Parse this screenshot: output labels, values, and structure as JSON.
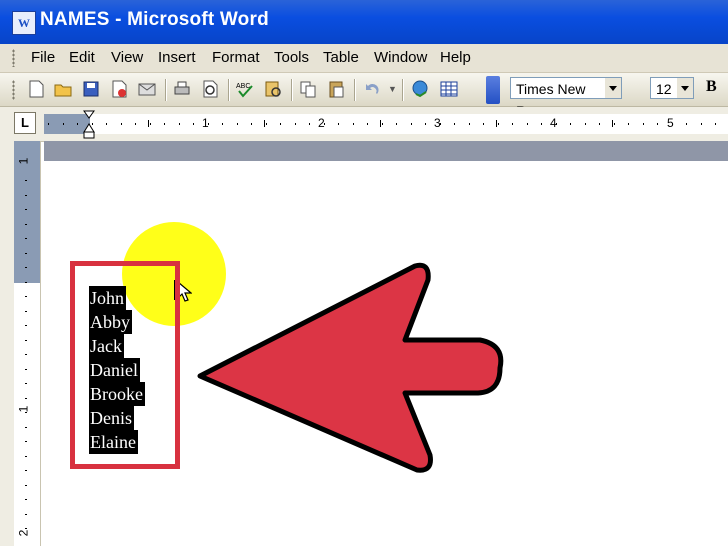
{
  "window": {
    "title": "NAMES - Microsoft Word",
    "app_icon_letter": "W"
  },
  "menu": [
    "File",
    "Edit",
    "View",
    "Insert",
    "Format",
    "Tools",
    "Table",
    "Window",
    "Help"
  ],
  "toolbar": {
    "icons": [
      "new-icon",
      "open-icon",
      "save-icon",
      "permission-icon",
      "email-icon",
      "print-icon",
      "print-preview-icon",
      "spelling-icon",
      "research-icon",
      "copy-icon",
      "paste-icon",
      "undo-icon",
      "hyperlink-icon",
      "table-icon"
    ],
    "font_name": "Times New Roman",
    "font_size": "12",
    "bold_label": "B"
  },
  "ruler": {
    "corner_label": "L",
    "numbers": [
      "1",
      "2",
      "3",
      "4",
      "5"
    ],
    "vertical_numbers": [
      "1",
      "1",
      "2"
    ]
  },
  "document": {
    "names": [
      "John",
      "Abby",
      "Jack",
      "Daniel",
      "Brooke",
      "Denis",
      "Elaine"
    ]
  },
  "colors": {
    "titlebar": "#0a4ee0",
    "highlight": "#ffff00",
    "annotation_red": "#d8313f",
    "selection": "#000000"
  }
}
